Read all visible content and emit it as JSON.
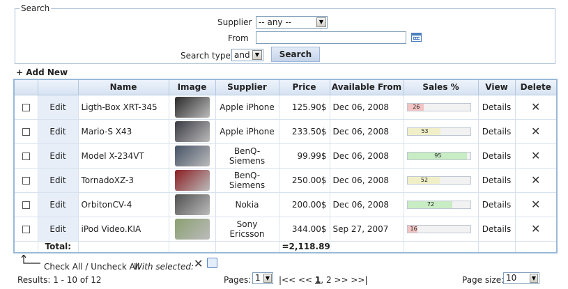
{
  "search": {
    "legend": "Search",
    "supplier_label": "Supplier",
    "supplier_value": "-- any --",
    "from_label": "From",
    "from_value": "",
    "type_label": "Search type:",
    "type_value": "and",
    "button": "Search"
  },
  "add_new": "+ Add New",
  "grid": {
    "columns": [
      "",
      "",
      "Name",
      "Image",
      "Supplier",
      "Price",
      "Available From",
      "Sales %",
      "View",
      "Delete"
    ],
    "rows": [
      {
        "edit": "Edit",
        "name": "Ligth-Box XRT-345",
        "supplier": "Apple iPhone",
        "price": "125.90$",
        "date": "Dec 06, 2008",
        "sales": 26,
        "sales_color": "#f2c4c4",
        "view": "Details",
        "thumb": "phone-image",
        "thumb_color": "#2a2a2a"
      },
      {
        "edit": "Edit",
        "name": "Mario-S X43",
        "supplier": "Apple iPhone",
        "price": "233.50$",
        "date": "Dec 06, 2008",
        "sales": 53,
        "sales_color": "#f0efc8",
        "view": "Details",
        "thumb": "phone-image",
        "thumb_color": "#3a3a44"
      },
      {
        "edit": "Edit",
        "name": "Model X-234VT",
        "supplier": "BenQ-Siemens",
        "price": "99.99$",
        "date": "Dec 06, 2008",
        "sales": 95,
        "sales_color": "#c8ecc4",
        "view": "Details",
        "thumb": "phone-image",
        "thumb_color": "#455266"
      },
      {
        "edit": "Edit",
        "name": "TornadoXZ-3",
        "supplier": "BenQ-Siemens",
        "price": "250.00$",
        "date": "Dec 06, 2008",
        "sales": 52,
        "sales_color": "#f0efc8",
        "view": "Details",
        "thumb": "phone-image",
        "thumb_color": "#8a1e22"
      },
      {
        "edit": "Edit",
        "name": "OrbitonCV-4",
        "supplier": "Nokia",
        "price": "200.00$",
        "date": "Dec 06, 2008",
        "sales": 72,
        "sales_color": "#c8ecc4",
        "view": "Details",
        "thumb": "phone-image",
        "thumb_color": "#505050"
      },
      {
        "edit": "Edit",
        "name": "iPod Video.KIA",
        "supplier": "Sony Ericsson",
        "price": "344.00$",
        "date": "Sep 27, 2007",
        "sales": 16,
        "sales_color": "#f2c4c4",
        "view": "Details",
        "thumb": "phone-image",
        "thumb_color": "#8aa070"
      }
    ],
    "total_label": "Total:",
    "total_price": "=2,118.89"
  },
  "footer": {
    "check_all": "Check All / Uncheck All",
    "with_selected": "With selected:",
    "results": "Results: 1 - 10 of 12",
    "pages_label": "Pages:",
    "pages_value": "1",
    "pager_first": "|<<",
    "pager_prev": "<<",
    "pager_page1": "1",
    "pager_sep": ",",
    "pager_page2": "2",
    "pager_next": ">>",
    "pager_last": ">>|",
    "page_size_label": "Page size:",
    "page_size_value": "10"
  }
}
